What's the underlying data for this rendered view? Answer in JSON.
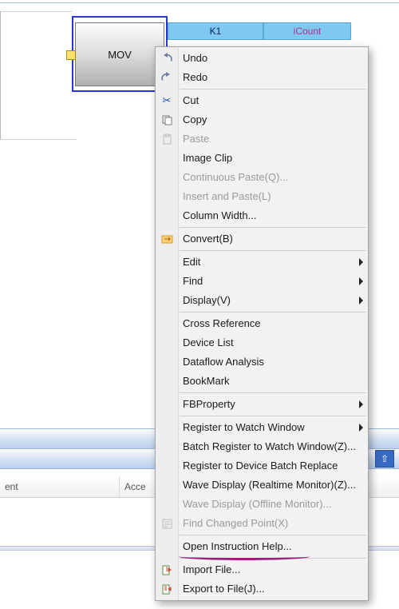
{
  "block": {
    "label": "MOV"
  },
  "headers": {
    "k1": "K1",
    "icount": "iCount"
  },
  "columns": {
    "ent": "ent",
    "acce": "Acce"
  },
  "pin_glyph": "⇧",
  "menu": {
    "undo": "Undo",
    "redo": "Redo",
    "cut": "Cut",
    "copy": "Copy",
    "paste": "Paste",
    "image_clip": "Image Clip",
    "continuous_paste": "Continuous Paste(Q)...",
    "insert_paste": "Insert and Paste(L)",
    "column_width": "Column Width...",
    "convert": "Convert(B)",
    "edit": "Edit",
    "find": "Find",
    "display": "Display(V)",
    "cross_reference": "Cross Reference",
    "device_list": "Device List",
    "dataflow": "Dataflow Analysis",
    "bookmark": "BookMark",
    "fbproperty": "FBProperty",
    "reg_watch": "Register to Watch Window",
    "batch_reg_watch": "Batch Register to Watch Window(Z)...",
    "reg_device_batch": "Register to Device Batch Replace",
    "wave_realtime": "Wave Display (Realtime Monitor)(Z)...",
    "wave_offline": "Wave Display (Offline Monitor)...",
    "find_changed": "Find Changed Point(X)",
    "open_help": "Open Instruction Help...",
    "import_file": "Import File...",
    "export_file": "Export to File(J)..."
  }
}
